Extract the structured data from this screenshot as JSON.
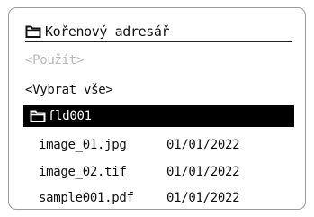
{
  "header": {
    "title": "Kořenový adresář",
    "icon": "folder-icon"
  },
  "menu": {
    "use_label": "<Použít>",
    "select_all_label": "<Vybrat vše>"
  },
  "selected_folder": {
    "name": "fld001",
    "icon": "folder-icon"
  },
  "files": [
    {
      "name": "image_01.jpg",
      "date": "01/01/2022"
    },
    {
      "name": "image_02.tif",
      "date": "01/01/2022"
    },
    {
      "name": "sample001.pdf",
      "date": "01/01/2022"
    }
  ],
  "colors": {
    "selected_bg": "#000000",
    "disabled_text": "#b8b8b8"
  }
}
